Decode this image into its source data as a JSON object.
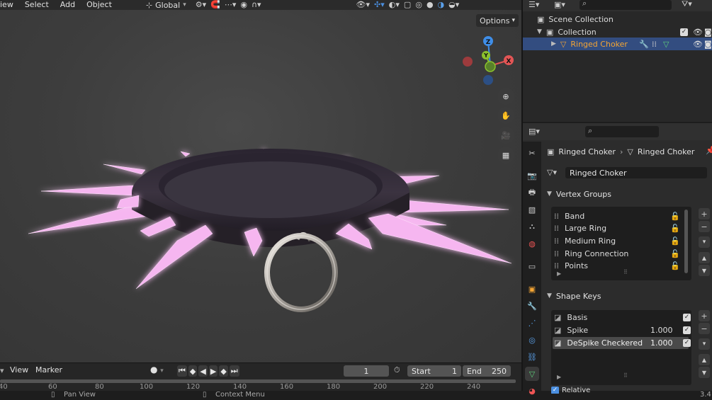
{
  "header": {
    "menus": [
      "iew",
      "Select",
      "Add",
      "Object"
    ],
    "transform_orientation": "Global",
    "options_label": "Options"
  },
  "gizmo": {
    "z": "Z",
    "y": "Y",
    "x": "X"
  },
  "colors": {
    "accent_orange": "#f4a534",
    "selection": "#334d80",
    "glow": "#f6b6f0",
    "axis_x": "#e25555",
    "axis_y": "#8bc12c",
    "axis_z": "#3f8ee8"
  },
  "timeline": {
    "menus": [
      "View",
      "Marker"
    ],
    "current_frame": "1",
    "start_label": "Start",
    "start_value": "1",
    "end_label": "End",
    "end_value": "250",
    "ticks": [
      "40",
      "60",
      "80",
      "100",
      "120",
      "140",
      "160",
      "180",
      "200",
      "220",
      "240"
    ]
  },
  "status": {
    "pan_view": "Pan View",
    "context_menu": "Context Menu",
    "version": "3.4"
  },
  "outliner": {
    "items": [
      {
        "label": "Scene Collection",
        "icon": "scene-collection-icon"
      },
      {
        "label": "Collection",
        "icon": "collection-icon"
      },
      {
        "label": "Ringed Choker",
        "icon": "mesh-object-icon"
      }
    ]
  },
  "properties": {
    "breadcrumb_object": "Ringed Choker",
    "breadcrumb_data": "Ringed Choker",
    "data_name": "Ringed Choker",
    "vertex_groups": {
      "title": "Vertex Groups",
      "items": [
        "Band",
        "Large Ring",
        "Medium Ring",
        "Ring Connection",
        "Points"
      ]
    },
    "shape_keys": {
      "title": "Shape Keys",
      "items": [
        {
          "name": "Basis",
          "value": ""
        },
        {
          "name": "Spike",
          "value": "1.000"
        },
        {
          "name": "DeSpike Checkered",
          "value": "1.000"
        }
      ]
    },
    "relative_label": "Relative"
  }
}
